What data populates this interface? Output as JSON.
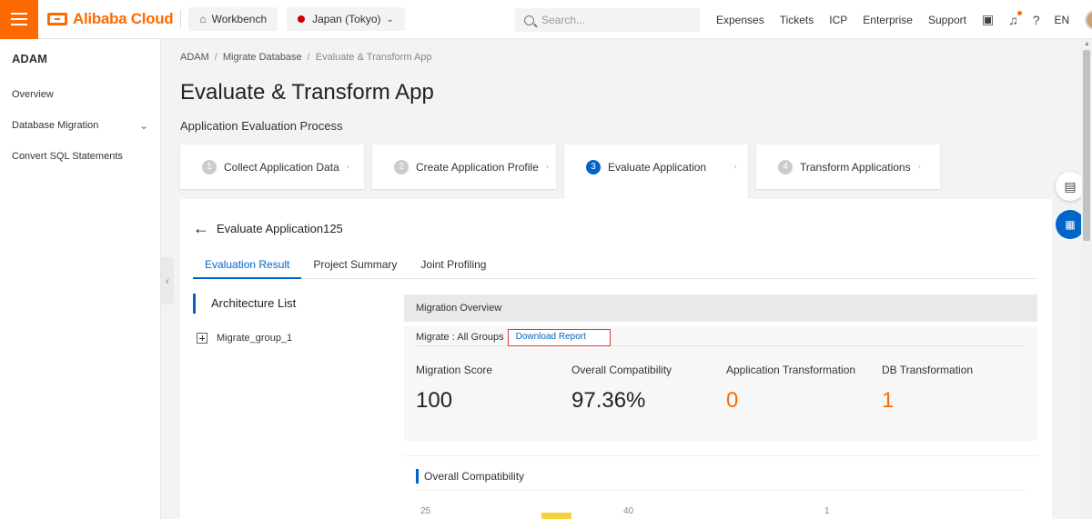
{
  "topbar": {
    "logo_text": "Alibaba Cloud",
    "workbench": "Workbench",
    "region": "Japan (Tokyo)",
    "search_placeholder": "Search...",
    "nav": [
      "Expenses",
      "Tickets",
      "ICP",
      "Enterprise",
      "Support"
    ],
    "lang": "EN",
    "brand_color": "#ff6a00"
  },
  "sidebar": {
    "title": "ADAM",
    "items": [
      {
        "label": "Overview"
      },
      {
        "label": "Database Migration"
      },
      {
        "label": "Convert SQL Statements"
      }
    ]
  },
  "breadcrumb": [
    "ADAM",
    "Migrate Database",
    "Evaluate & Transform App"
  ],
  "page_title": "Evaluate & Transform App",
  "process_title": "Application Evaluation Process",
  "steps": [
    {
      "num": "1",
      "label": "Collect Application Data"
    },
    {
      "num": "2",
      "label": "Create Application Profile"
    },
    {
      "num": "3",
      "label": "Evaluate Application"
    },
    {
      "num": "4",
      "label": "Transform Applications"
    }
  ],
  "active_step": 3,
  "evaluation": {
    "back_title": "Evaluate Application125",
    "tabs": [
      "Evaluation Result",
      "Project Summary",
      "Joint Profiling"
    ],
    "architecture_title": "Architecture List",
    "tree_item": "Migrate_group_1",
    "overview_title": "Migration Overview",
    "migrate_label": "Migrate : All Groups",
    "download_label": "Download Report",
    "metrics": [
      {
        "label": "Migration Score",
        "value": "100"
      },
      {
        "label": "Overall Compatibility",
        "value": "97.36%"
      },
      {
        "label": "Application Transformation",
        "value": "0"
      },
      {
        "label": "DB Transformation",
        "value": "1"
      }
    ],
    "compat_title": "Overall Compatibility",
    "compat_ticks": [
      "25",
      "40",
      "1"
    ]
  },
  "accent_color": "#0064c8"
}
